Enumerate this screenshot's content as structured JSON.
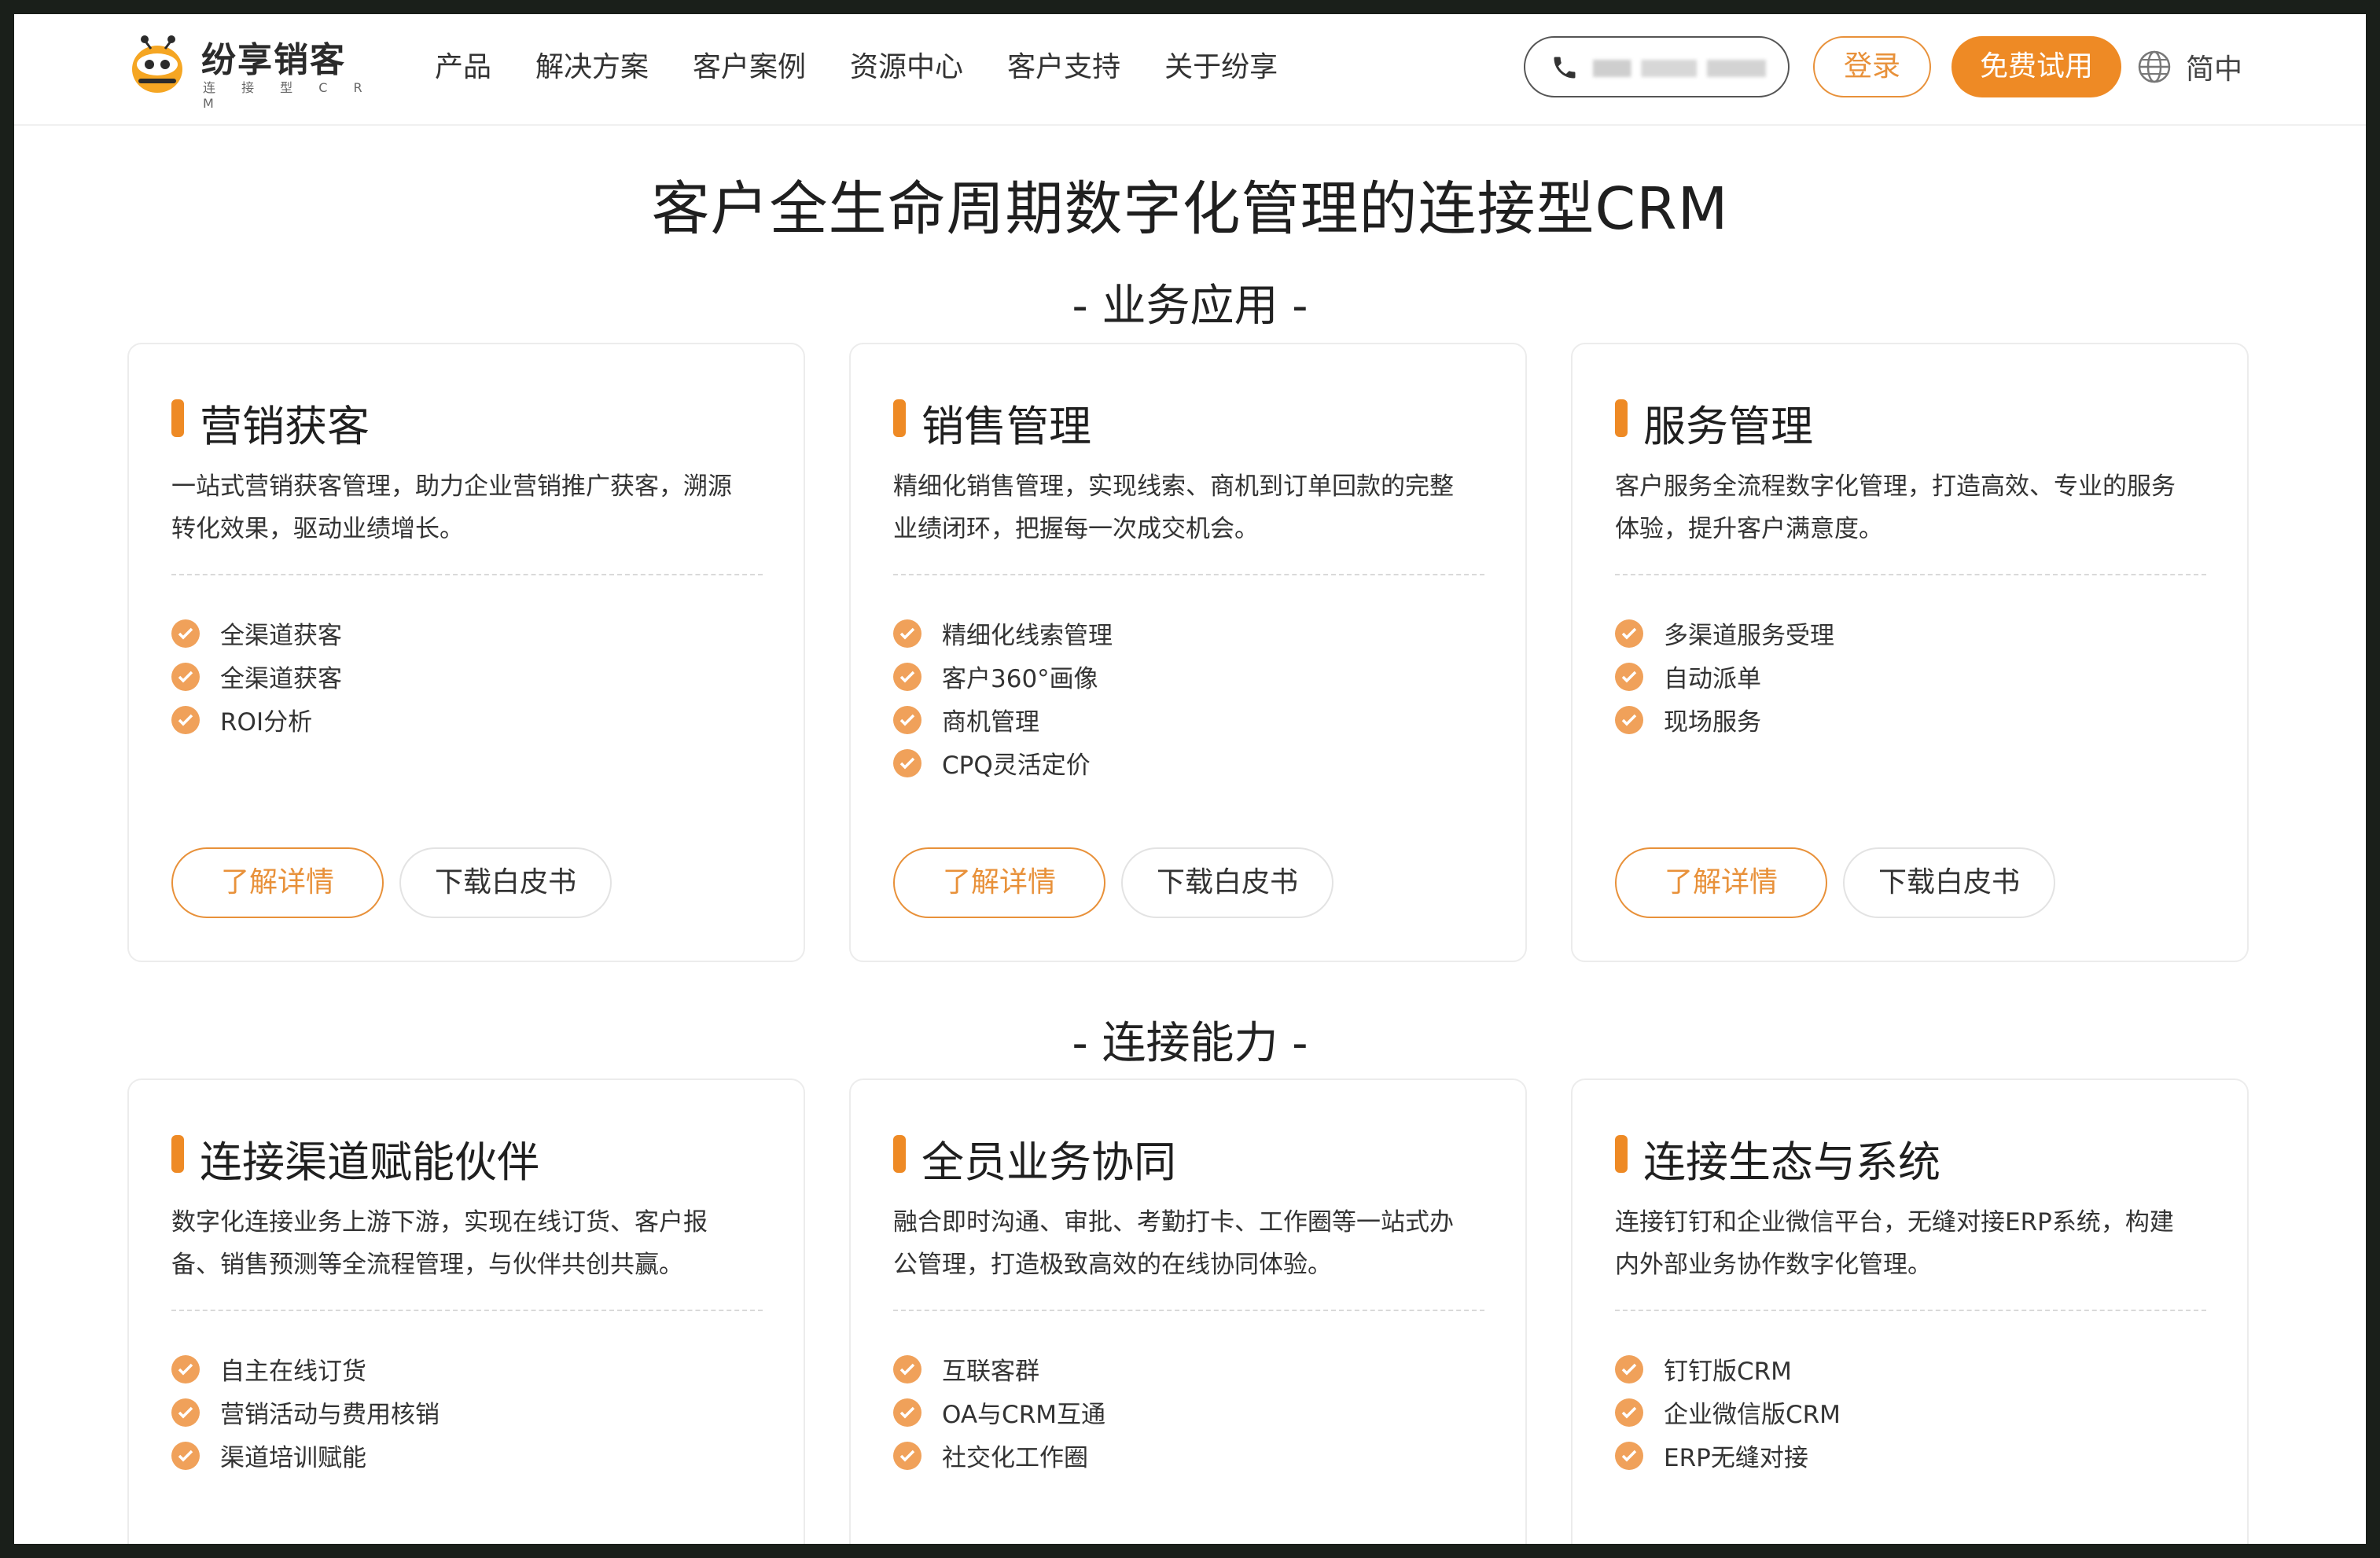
{
  "header": {
    "logo_text": "纷享销客",
    "logo_sub": "连 接 型 C R M",
    "nav": [
      "产品",
      "解决方案",
      "客户案例",
      "资源中心",
      "客户支持",
      "关于纷享"
    ],
    "login_label": "登录",
    "trial_label": "免费试用",
    "lang_label": "简中"
  },
  "page_title": "客户全生命周期数字化管理的连接型CRM",
  "sections": [
    {
      "title": "- 业务应用 -",
      "cards": [
        {
          "title": "营销获客",
          "desc": "一站式营销获客管理，助力企业营销推广获客，溯源转化效果，驱动业绩增长。",
          "features": [
            "全渠道获客",
            "全渠道获客",
            "ROI分析"
          ],
          "detail_label": "了解详情",
          "download_label": "下载白皮书"
        },
        {
          "title": "销售管理",
          "desc": "精细化销售管理，实现线索、商机到订单回款的完整业绩闭环，把握每一次成交机会。",
          "features": [
            "精细化线索管理",
            "客户360°画像",
            "商机管理",
            "CPQ灵活定价"
          ],
          "detail_label": "了解详情",
          "download_label": "下载白皮书"
        },
        {
          "title": "服务管理",
          "desc": "客户服务全流程数字化管理，打造高效、专业的服务体验，提升客户满意度。",
          "features": [
            "多渠道服务受理",
            "自动派单",
            "现场服务"
          ],
          "detail_label": "了解详情",
          "download_label": "下载白皮书"
        }
      ]
    },
    {
      "title": "- 连接能力 -",
      "cards": [
        {
          "title": "连接渠道赋能伙伴",
          "desc": "数字化连接业务上游下游，实现在线订货、客户报备、销售预测等全流程管理，与伙伴共创共赢。",
          "features": [
            "自主在线订货",
            "营销活动与费用核销",
            "渠道培训赋能"
          ]
        },
        {
          "title": "全员业务协同",
          "desc": "融合即时沟通、审批、考勤打卡、工作圈等一站式办公管理，打造极致高效的在线协同体验。",
          "features": [
            "互联客群",
            "OA与CRM互通",
            "社交化工作圈"
          ]
        },
        {
          "title": "连接生态与系统",
          "desc": "连接钉钉和企业微信平台，无缝对接ERP系统，构建内外部业务协作数字化管理。",
          "features": [
            "钉钉版CRM",
            "企业微信版CRM",
            "ERP无缝对接"
          ]
        }
      ]
    }
  ],
  "colors": {
    "accent": "#ee8a25",
    "check": "#f0a15a"
  }
}
